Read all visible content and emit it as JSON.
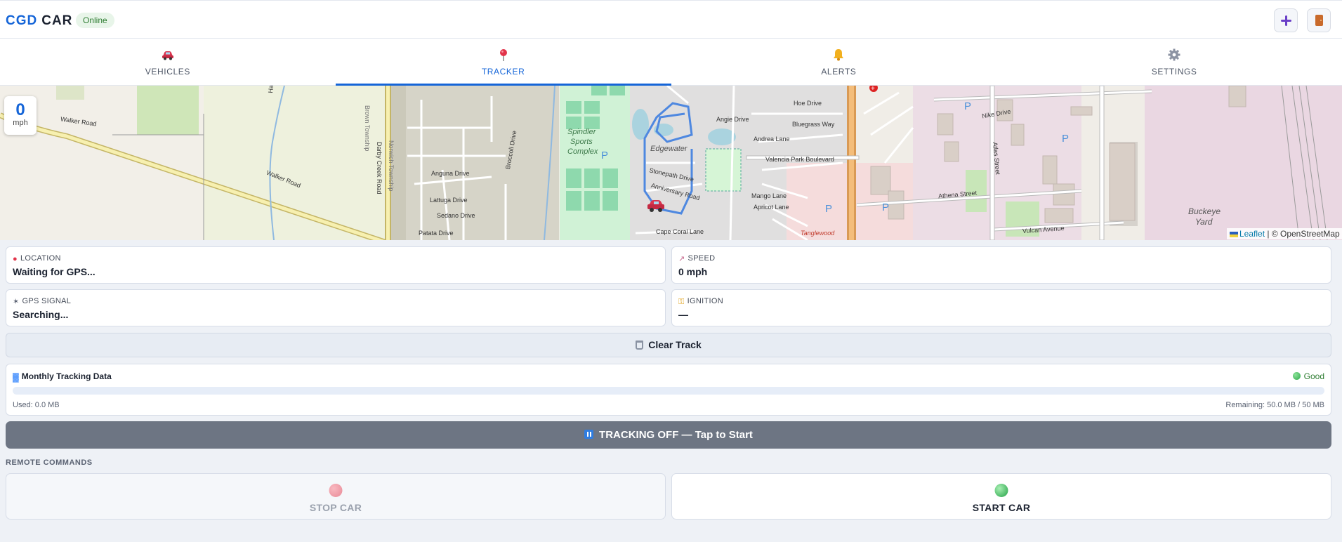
{
  "header": {
    "brand_part1": "CGD",
    "brand_part2": "CAR",
    "status": "Online",
    "icons": [
      "plus-icon",
      "door-icon"
    ]
  },
  "tabs": [
    {
      "label": "VEHICLES",
      "icon": "car-icon",
      "active": false
    },
    {
      "label": "TRACKER",
      "icon": "pin-icon",
      "active": true
    },
    {
      "label": "ALERTS",
      "icon": "bell-icon",
      "active": false
    },
    {
      "label": "SETTINGS",
      "icon": "gear-icon",
      "active": false
    }
  ],
  "map": {
    "speed_value": "0",
    "speed_unit": "mph",
    "attribution_leaflet": "Leaflet",
    "attribution_rest": "| © OpenStreetMap",
    "labels": {
      "walker_road_1": "Walker Road",
      "walker_road_2": "Walker Road",
      "hamilton": "Hamilton R",
      "darby": "Darby Creek Road",
      "brown": "Brown Township",
      "norwich": "Norwich Township",
      "anguna": "Anguna Drive",
      "lattuga": "Lattuga Drive",
      "sedano": "Sedano Drive",
      "patata": "Patata Drive",
      "broccoli": "Broccoli Drive",
      "spindler": "Spindler",
      "sports": "Sports",
      "complex": "Complex",
      "edgewater": "Edgewater",
      "stonepath": "Stonepath Drive",
      "anniversary": "Anniversary Road",
      "cape_coral": "Cape Coral Lane",
      "angie": "Angie Drive",
      "bluegrass": "Bluegrass Way",
      "andrea": "Andrea Lane",
      "valencia": "Valencia Park Boulevard",
      "mango": "Mango Lane",
      "apricot": "Apricot Lane",
      "tanglewood": "Tanglewood",
      "nike": "Nike Drive",
      "athena": "Athena Street",
      "atlas": "Atlas Street",
      "vulcan": "Vulcan Avenue",
      "buckeye": "Buckeye",
      "yard": "Yard",
      "hoe": "Hoe Drive"
    }
  },
  "info": {
    "location_label": "LOCATION",
    "location_value": "Waiting for GPS...",
    "speed_label": "SPEED",
    "speed_value": "0 mph",
    "gps_label": "GPS SIGNAL",
    "gps_value": "Searching...",
    "ignition_label": "IGNITION",
    "ignition_value": "—"
  },
  "clear_button": "Clear Track",
  "monthly": {
    "title": "Monthly Tracking Data",
    "status": "Good",
    "used": "Used: 0.0 MB",
    "remaining": "Remaining: 50.0 MB / 50 MB",
    "usage_fraction": 0.0
  },
  "tracking_button": "TRACKING OFF — Tap to Start",
  "remote": {
    "title": "REMOTE COMMANDS",
    "stop_label": "STOP CAR",
    "start_label": "START CAR"
  }
}
